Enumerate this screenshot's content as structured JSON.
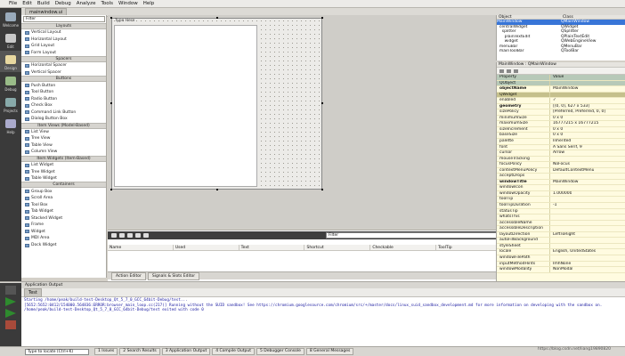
{
  "menus": [
    "File",
    "Edit",
    "Build",
    "Debug",
    "Analyze",
    "Tools",
    "Window",
    "Help"
  ],
  "modes": [
    {
      "label": "Welcome",
      "icon": "welcome-icon"
    },
    {
      "label": "Edit",
      "icon": "edit-icon"
    },
    {
      "label": "Design",
      "icon": "design-icon"
    },
    {
      "label": "Debug",
      "icon": "debug-icon"
    },
    {
      "label": "Projects",
      "icon": "projects-icon"
    },
    {
      "label": "Help",
      "icon": "help-icon"
    }
  ],
  "file_tab": "mainwindow.ui",
  "widget_box": {
    "filter_placeholder": "Filter",
    "sections": [
      {
        "title": "Layouts",
        "items": [
          "Vertical Layout",
          "Horizontal Layout",
          "Grid Layout",
          "Form Layout"
        ]
      },
      {
        "title": "Spacers",
        "items": [
          "Horizontal Spacer",
          "Vertical Spacer"
        ]
      },
      {
        "title": "Buttons",
        "items": [
          "Push Button",
          "Tool Button",
          "Radio Button",
          "Check Box",
          "Command Link Button",
          "Dialog Button Box"
        ]
      },
      {
        "title": "Item Views (Model-Based)",
        "items": [
          "List View",
          "Tree View",
          "Table View",
          "Column View"
        ]
      },
      {
        "title": "Item Widgets (Item-Based)",
        "items": [
          "List Widget",
          "Tree Widget",
          "Table Widget"
        ]
      },
      {
        "title": "Containers",
        "items": [
          "Group Box",
          "Scroll Area",
          "Tool Box",
          "Tab Widget",
          "Stacked Widget",
          "Frame",
          "Widget",
          "MDI Area",
          "Dock Widget"
        ]
      }
    ]
  },
  "form": {
    "menu_placeholder": "Type Here"
  },
  "action_editor": {
    "filter_placeholder": "Filter",
    "columns": [
      "Name",
      "Used",
      "Text",
      "Shortcut",
      "Checkable",
      "ToolTip"
    ],
    "tabs": [
      "Action Editor",
      "Signals & Slots Editor"
    ]
  },
  "object_inspector": {
    "columns": [
      "Object",
      "Class"
    ],
    "rows": [
      {
        "object": "MainWindow",
        "class": "QMainWindow",
        "selected": true
      },
      {
        "object": "  centralWidget",
        "class": "QWidget"
      },
      {
        "object": "    splitter",
        "class": "QSplitter"
      },
      {
        "object": "      plainTextEdit",
        "class": "QPlainTextEdit"
      },
      {
        "object": "      widget",
        "class": "QWebEngineView"
      },
      {
        "object": "  menuBar",
        "class": "QMenuBar"
      },
      {
        "object": "  mainToolBar",
        "class": "QToolBar"
      }
    ]
  },
  "property_editor": {
    "header": "MainWindow : QMainWindow",
    "columns": [
      "Property",
      "Value"
    ],
    "rows": [
      {
        "p": "QObject",
        "v": "",
        "group": true
      },
      {
        "p": "objectName",
        "v": "MainWindow",
        "bold": true
      },
      {
        "p": "QWidget",
        "v": "",
        "group": true
      },
      {
        "p": "enabled",
        "v": "✓"
      },
      {
        "p": "geometry",
        "v": "[(0, 0), 627 x 533]",
        "bold": true
      },
      {
        "p": "sizePolicy",
        "v": "[Preferred, Preferred, 0, 0]"
      },
      {
        "p": "minimumSize",
        "v": "0 x 0"
      },
      {
        "p": "maximumSize",
        "v": "16777215 x 16777215"
      },
      {
        "p": "sizeIncrement",
        "v": "0 x 0"
      },
      {
        "p": "baseSize",
        "v": "0 x 0"
      },
      {
        "p": "palette",
        "v": "Inherited"
      },
      {
        "p": "font",
        "v": "A  Sans Serif, 9"
      },
      {
        "p": "cursor",
        "v": "Arrow"
      },
      {
        "p": "mouseTracking",
        "v": ""
      },
      {
        "p": "focusPolicy",
        "v": "NoFocus"
      },
      {
        "p": "contextMenuPolicy",
        "v": "DefaultContextMenu"
      },
      {
        "p": "acceptDrops",
        "v": ""
      },
      {
        "p": "windowTitle",
        "v": "MainWindow",
        "bold": true
      },
      {
        "p": "windowIcon",
        "v": ""
      },
      {
        "p": "windowOpacity",
        "v": "1.000000"
      },
      {
        "p": "toolTip",
        "v": ""
      },
      {
        "p": "toolTipDuration",
        "v": "-1"
      },
      {
        "p": "statusTip",
        "v": ""
      },
      {
        "p": "whatsThis",
        "v": ""
      },
      {
        "p": "accessibleName",
        "v": ""
      },
      {
        "p": "accessibleDescription",
        "v": ""
      },
      {
        "p": "layoutDirection",
        "v": "LeftToRight"
      },
      {
        "p": "autoFillBackground",
        "v": ""
      },
      {
        "p": "styleSheet",
        "v": ""
      },
      {
        "p": "locale",
        "v": "English, UnitedStates"
      },
      {
        "p": "windowFilePath",
        "v": ""
      },
      {
        "p": "inputMethodHints",
        "v": "ImhNone"
      },
      {
        "p": "windowModality",
        "v": "NonModal"
      }
    ]
  },
  "output": {
    "pane_label": "Application Output",
    "tab": "Test",
    "lines": [
      "Starting /home/peak/build-test-Desktop_Qt_5_7_0_GCC_64bit-Debug/test...",
      "[5652:5652:0412/154000.564836:ERROR:browser_main_loop.cc(217)] Running without the SUID sandbox! See https://chromium.googlesource.com/chromium/src/+/master/docs/linux_suid_sandbox_development.md for more information on developing with the sandbox on.",
      "/home/peak/build-test-Desktop_Qt_5_7_0_GCC_64bit-Debug/test exited with code 0"
    ]
  },
  "status": {
    "locator_placeholder": "Type to locate (Ctrl+K)",
    "tabs": [
      "1 Issues",
      "2 Search Results",
      "3 Application Output",
      "4 Compile Output",
      "5 Debugger Console",
      "8 General Messages"
    ]
  },
  "watermark": "https://blog.csdn.net/liang19890820"
}
